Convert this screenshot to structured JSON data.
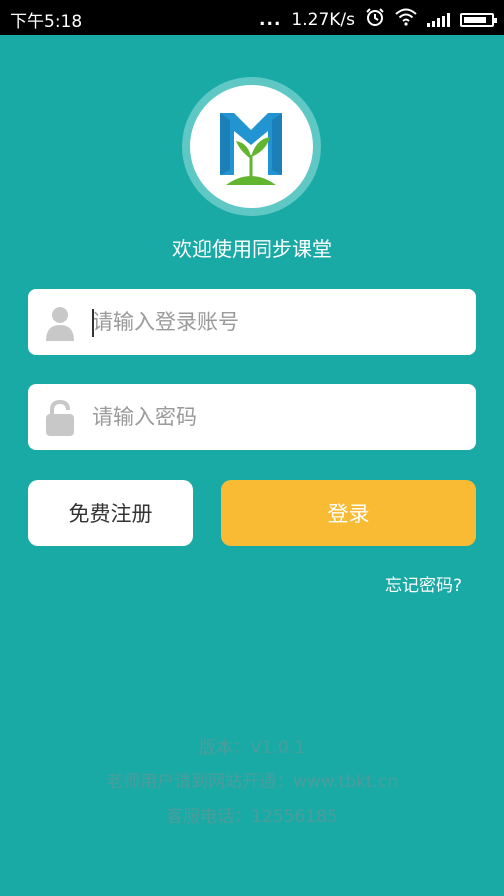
{
  "status_bar": {
    "time": "下午5:18",
    "dots": "...",
    "network_speed": "1.27K/s",
    "icons": [
      "alarm-icon",
      "wifi-icon",
      "signal-icon",
      "battery-icon"
    ],
    "battery_level": 0.85
  },
  "app": {
    "logo_icon": "book-sprout-logo",
    "welcome_text": "欢迎使用同步课堂"
  },
  "login_form": {
    "account_placeholder": "请输入登录账号",
    "account_icon": "user-icon",
    "password_placeholder": "请输入密码",
    "password_icon": "lock-icon",
    "register_label": "免费注册",
    "login_label": "登录",
    "forgot_label": "忘记密码?"
  },
  "footer": {
    "version": "版本：V1.0.1",
    "teacher_note": "老师用户请到网站开通：www.tbkt.cn",
    "service_phone": "客服电话：12556185"
  },
  "colors": {
    "background": "#1aaaa6",
    "login_button": "#f9bb34",
    "footer_text": "#4b9d9b"
  }
}
